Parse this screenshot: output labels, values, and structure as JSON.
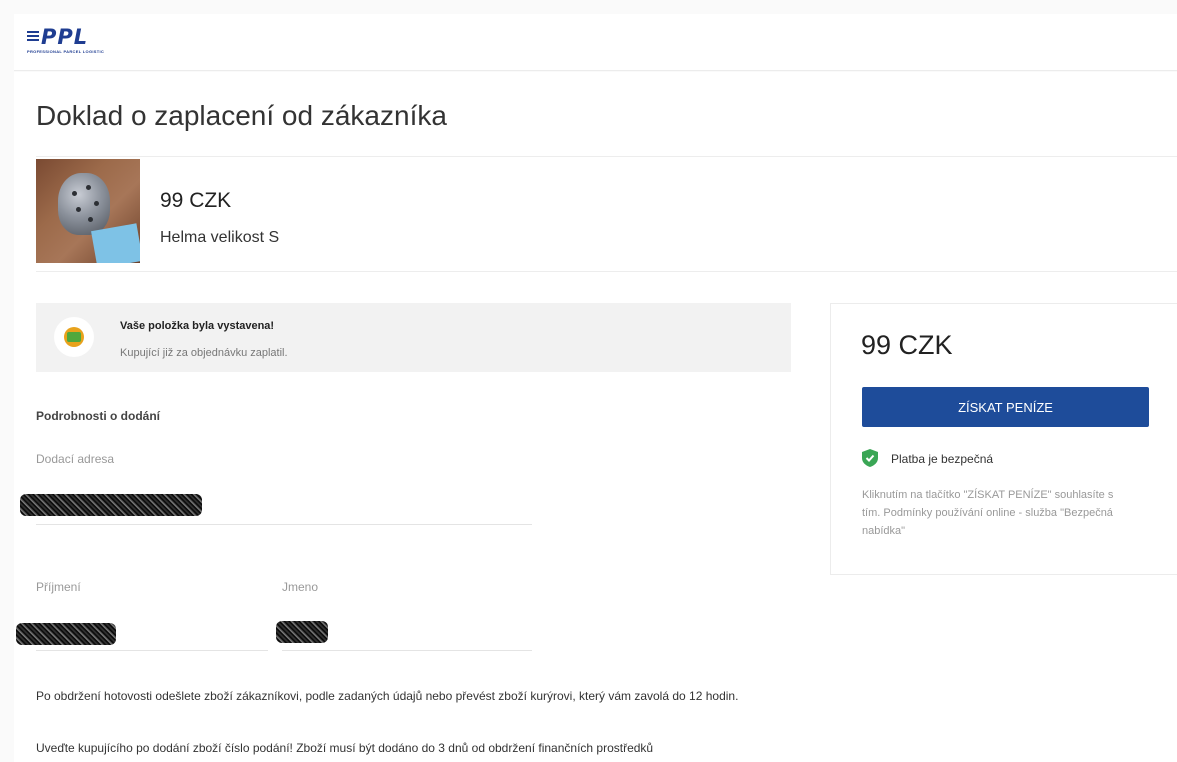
{
  "header": {
    "logo_text": "PPL",
    "logo_sub": "PROFESSIONAL PARCEL LOGISTIC"
  },
  "page": {
    "title": "Doklad o zaplacení od zákazníka"
  },
  "product": {
    "price": "99 CZK",
    "name": "Helma velikost S"
  },
  "notice": {
    "title": "Vaše položka byla vystavena!",
    "text": "Kupující již za objednávku zaplatil."
  },
  "delivery": {
    "section_title": "Podrobnosti o dodání",
    "address_label": "Dodací adresa",
    "surname_label": "Příjmení",
    "firstname_label": "Jmeno"
  },
  "info": {
    "paragraph1": "Po obdržení hotovosti odešlete zboží zákazníkovi, podle zadaných údajů nebo převést zboží kurýrovi, který vám zavolá do 12 hodin.",
    "paragraph2": "Uveďte kupujícího po dodání zboží číslo podání! Zboží musí být dodáno do 3 dnů od obdržení finančních prostředků"
  },
  "sidebar": {
    "price": "99 CZK",
    "button_label": "ZÍSKAT PENÍZE",
    "secure_text": "Platba je bezpečná",
    "terms": "Kliknutím na tlačítko \"ZÍSKAT PENÍZE\" souhlasíte s tím. Podmínky používání online - služba \"Bezpečná nabídka\""
  },
  "colors": {
    "brand_blue": "#1e4c9a",
    "shield_green": "#3aa655"
  }
}
